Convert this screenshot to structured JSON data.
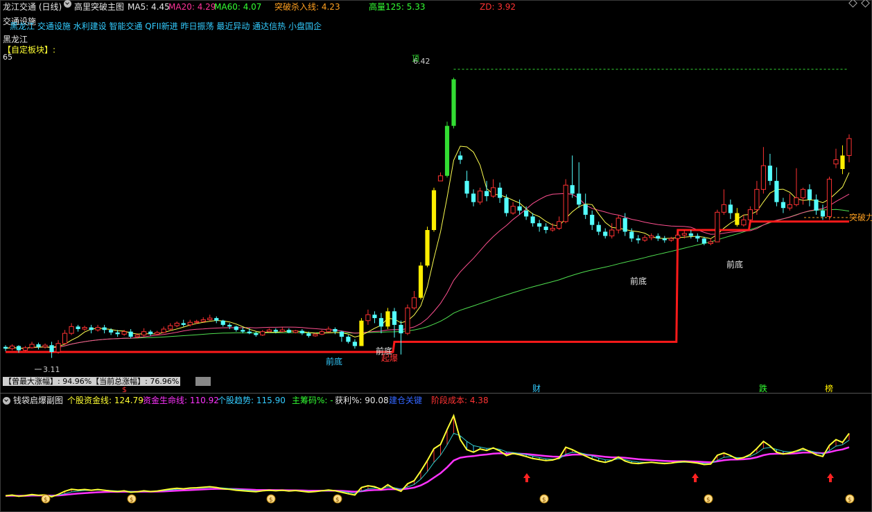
{
  "header": {
    "title": "龙江交通 (日线)",
    "formula": "高里突破主图",
    "ma5_label": "MA5: 4.45",
    "ma20_label": "MA20: 4.29",
    "ma60_label": "MA60: 4.07",
    "breakout_line": "突破杀入线: 4.23",
    "high_vol": "高量125: 5.33",
    "zd": "ZD: 3.92"
  },
  "info": {
    "industry": "交通设施",
    "tags_overlay": "黑龙江 交通设施 水利建设 智能交通 QFII新进 昨日振荡 最近异动 通达信热 小盘国企",
    "region": "黑龙江",
    "custom_block": "【自定板块】:",
    "custom_value": "65"
  },
  "chart_labels": {
    "price_low": "3.11",
    "price_high": "6.42",
    "top_label": "顶",
    "front_bottom": "前底",
    "ignite": "起爆",
    "breakout_right": "突破力",
    "markers": [
      "$",
      "财",
      "跌",
      "榜"
    ]
  },
  "stats": {
    "text": "【曾最大涨幅】: 94.96%【当前总涨幅】: 76.96%"
  },
  "sub": {
    "title": "钱袋启爆副图",
    "fund_line": "个股资金线: 124.79",
    "life_line": "资金生命线: 110.92",
    "trend": "个股趋势: 115.90",
    "main_chip": "主筹码%: -",
    "profit": "获利%: 90.08",
    "bottom": "建仓关键",
    "cost": "阶段成本: 4.38"
  },
  "colors": {
    "up": "#ff3232",
    "down": "#54ffff",
    "ma5": "#ffff50",
    "ma20": "#ff5090",
    "ma60": "#50e050",
    "support": "#ff1a1a",
    "fund": "#ffff33",
    "life": "#ff33ff",
    "trend": "#33cccc"
  },
  "chart_data": {
    "type": "candlestick",
    "note": "daily OHLC estimated visually",
    "candles": [
      [
        3.24,
        3.22,
        3.26,
        3.19
      ],
      [
        3.22,
        3.25,
        3.27,
        3.2
      ],
      [
        3.25,
        3.2,
        3.26,
        3.17
      ],
      [
        3.2,
        3.23,
        3.25,
        3.19
      ],
      [
        3.23,
        3.27,
        3.3,
        3.22
      ],
      [
        3.27,
        3.24,
        3.29,
        3.21
      ],
      [
        3.24,
        3.26,
        3.28,
        3.22
      ],
      [
        3.26,
        3.18,
        3.3,
        3.11
      ],
      [
        3.18,
        3.28,
        3.32,
        3.16
      ],
      [
        3.28,
        3.4,
        3.44,
        3.27
      ],
      [
        3.4,
        3.48,
        3.52,
        3.38
      ],
      [
        3.48,
        3.45,
        3.5,
        3.42
      ],
      [
        3.45,
        3.47,
        3.49,
        3.43
      ],
      [
        3.47,
        3.44,
        3.5,
        3.4
      ],
      [
        3.44,
        3.47,
        3.5,
        3.42
      ],
      [
        3.47,
        3.44,
        3.5,
        3.4
      ],
      [
        3.44,
        3.41,
        3.46,
        3.38
      ],
      [
        3.41,
        3.39,
        3.44,
        3.36
      ],
      [
        3.39,
        3.42,
        3.44,
        3.37
      ],
      [
        3.42,
        3.36,
        3.45,
        3.34
      ],
      [
        3.36,
        3.38,
        3.4,
        3.34
      ],
      [
        3.38,
        3.42,
        3.46,
        3.36
      ],
      [
        3.42,
        3.39,
        3.44,
        3.37
      ],
      [
        3.39,
        3.41,
        3.43,
        3.38
      ],
      [
        3.41,
        3.45,
        3.48,
        3.4
      ],
      [
        3.45,
        3.49,
        3.52,
        3.43
      ],
      [
        3.49,
        3.52,
        3.54,
        3.47
      ],
      [
        3.52,
        3.5,
        3.56,
        3.48
      ],
      [
        3.5,
        3.53,
        3.56,
        3.48
      ],
      [
        3.53,
        3.54,
        3.56,
        3.51
      ],
      [
        3.54,
        3.56,
        3.59,
        3.53
      ],
      [
        3.56,
        3.58,
        3.62,
        3.55
      ],
      [
        3.58,
        3.55,
        3.6,
        3.52
      ],
      [
        3.55,
        3.5,
        3.56,
        3.48
      ],
      [
        3.5,
        3.48,
        3.52,
        3.45
      ],
      [
        3.48,
        3.44,
        3.49,
        3.42
      ],
      [
        3.44,
        3.42,
        3.47,
        3.4
      ],
      [
        3.42,
        3.4,
        3.46,
        3.39
      ],
      [
        3.4,
        3.38,
        3.42,
        3.36
      ],
      [
        3.38,
        3.42,
        3.44,
        3.37
      ],
      [
        3.42,
        3.44,
        3.46,
        3.41
      ],
      [
        3.44,
        3.42,
        3.46,
        3.4
      ],
      [
        3.42,
        3.44,
        3.47,
        3.41
      ],
      [
        3.44,
        3.41,
        3.46,
        3.4
      ],
      [
        3.41,
        3.43,
        3.44,
        3.4
      ],
      [
        3.43,
        3.4,
        3.45,
        3.38
      ],
      [
        3.4,
        3.37,
        3.42,
        3.35
      ],
      [
        3.37,
        3.39,
        3.41,
        3.36
      ],
      [
        3.39,
        3.42,
        3.44,
        3.38
      ],
      [
        3.42,
        3.45,
        3.48,
        3.41
      ],
      [
        3.45,
        3.42,
        3.47,
        3.39
      ],
      [
        3.42,
        3.36,
        3.43,
        3.3
      ],
      [
        3.36,
        3.3,
        3.38,
        3.28
      ],
      [
        3.3,
        3.25,
        3.33,
        3.22
      ],
      [
        3.25,
        3.55,
        3.58,
        3.25
      ],
      [
        3.55,
        3.62,
        3.68,
        3.5
      ],
      [
        3.62,
        3.58,
        3.66,
        3.52
      ],
      [
        3.58,
        3.48,
        3.64,
        3.4
      ],
      [
        3.48,
        3.66,
        3.7,
        3.45
      ],
      [
        3.66,
        3.5,
        3.7,
        3.35
      ],
      [
        3.5,
        3.4,
        3.55,
        3.15
      ],
      [
        3.4,
        3.7,
        3.74,
        3.38
      ],
      [
        3.7,
        3.82,
        3.9,
        3.68
      ],
      [
        3.82,
        4.2,
        4.24,
        3.8
      ],
      [
        4.2,
        4.62,
        4.66,
        4.18
      ],
      [
        4.62,
        5.09,
        5.12,
        4.6
      ],
      [
        5.2,
        5.26,
        5.3,
        5.2
      ],
      [
        5.26,
        5.85,
        5.9,
        5.24
      ],
      [
        5.85,
        6.4,
        6.42,
        5.82
      ],
      [
        5.5,
        5.45,
        5.55,
        5.4
      ],
      [
        5.2,
        5.05,
        5.32,
        5.0
      ],
      [
        5.05,
        4.95,
        5.1,
        4.9
      ],
      [
        4.95,
        5.08,
        5.12,
        4.92
      ],
      [
        5.08,
        5.02,
        5.2,
        4.96
      ],
      [
        5.02,
        5.12,
        5.22,
        5.0
      ],
      [
        5.12,
        5.0,
        5.18,
        4.94
      ],
      [
        5.0,
        4.82,
        5.04,
        4.78
      ],
      [
        4.82,
        4.9,
        4.95,
        4.8
      ],
      [
        4.9,
        4.85,
        4.98,
        4.8
      ],
      [
        4.85,
        4.78,
        4.9,
        4.74
      ],
      [
        4.78,
        4.7,
        4.82,
        4.66
      ],
      [
        4.7,
        4.66,
        4.74,
        4.6
      ],
      [
        4.66,
        4.62,
        4.7,
        4.58
      ],
      [
        4.62,
        4.64,
        4.7,
        4.6
      ],
      [
        4.64,
        4.72,
        4.78,
        4.62
      ],
      [
        4.72,
        5.15,
        5.22,
        4.7
      ],
      [
        5.15,
        5.05,
        5.5,
        5.0
      ],
      [
        5.05,
        4.92,
        5.42,
        4.88
      ],
      [
        4.92,
        4.8,
        5.05,
        4.75
      ],
      [
        4.8,
        4.68,
        4.85,
        4.62
      ],
      [
        4.68,
        4.6,
        4.72,
        4.56
      ],
      [
        4.6,
        4.55,
        4.64,
        4.52
      ],
      [
        4.55,
        4.62,
        4.7,
        4.52
      ],
      [
        4.62,
        4.76,
        4.8,
        4.58
      ],
      [
        4.76,
        4.6,
        4.82,
        4.55
      ],
      [
        4.6,
        4.52,
        4.64,
        4.48
      ],
      [
        4.52,
        4.5,
        4.56,
        4.46
      ],
      [
        4.5,
        4.53,
        4.56,
        4.48
      ],
      [
        4.53,
        4.55,
        4.58,
        4.5
      ],
      [
        4.55,
        4.52,
        4.58,
        4.49
      ],
      [
        4.52,
        4.5,
        4.55,
        4.47
      ],
      [
        4.5,
        4.52,
        4.54,
        4.48
      ],
      [
        4.52,
        4.56,
        4.6,
        4.5
      ],
      [
        4.56,
        4.58,
        4.62,
        4.52
      ],
      [
        4.58,
        4.55,
        4.62,
        4.52
      ],
      [
        4.55,
        4.52,
        4.58,
        4.48
      ],
      [
        4.52,
        4.46,
        4.54,
        4.44
      ],
      [
        4.46,
        4.48,
        4.52,
        4.44
      ],
      [
        4.48,
        4.83,
        4.86,
        4.48
      ],
      [
        4.83,
        4.92,
        5.1,
        4.8
      ],
      [
        4.92,
        4.82,
        4.98,
        4.75
      ],
      [
        4.82,
        4.68,
        4.88,
        4.66
      ],
      [
        4.68,
        4.74,
        4.8,
        4.66
      ],
      [
        4.74,
        4.86,
        4.9,
        4.72
      ],
      [
        4.86,
        5.1,
        5.2,
        4.8
      ],
      [
        5.1,
        5.38,
        5.6,
        5.05
      ],
      [
        5.38,
        5.2,
        5.52,
        5.15
      ],
      [
        5.2,
        4.95,
        5.36,
        4.9
      ],
      [
        4.95,
        4.88,
        5.0,
        4.82
      ],
      [
        4.88,
        4.92,
        5.05,
        4.85
      ],
      [
        4.92,
        5.0,
        5.35,
        4.9
      ],
      [
        5.0,
        5.1,
        5.12,
        4.92
      ],
      [
        5.1,
        4.98,
        5.16,
        4.9
      ],
      [
        4.98,
        4.85,
        5.04,
        4.8
      ],
      [
        4.85,
        4.78,
        4.92,
        4.74
      ],
      [
        4.78,
        5.22,
        5.25,
        4.74
      ],
      [
        5.4,
        5.45,
        5.58,
        5.35
      ],
      [
        5.5,
        5.34,
        5.62,
        5.28
      ],
      [
        5.5,
        5.7,
        5.75,
        5.42
      ]
    ]
  }
}
